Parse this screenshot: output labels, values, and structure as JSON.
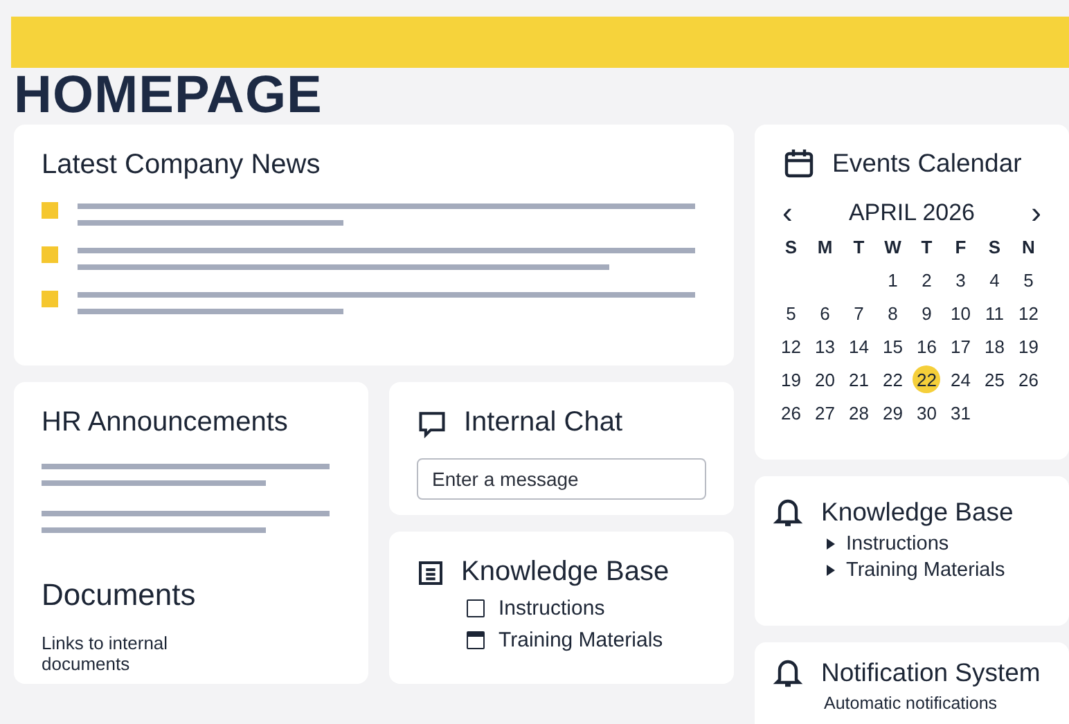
{
  "page_title": "HOMEPAGE",
  "news": {
    "title": "Latest Company News"
  },
  "hr": {
    "title": "HR Announcements"
  },
  "documents": {
    "title": "Documents",
    "description": "Links to internal documents"
  },
  "chat": {
    "title": "Internal Chat",
    "placeholder": "Enter a message"
  },
  "knowledge_base": {
    "title": "Knowledge Base",
    "items": [
      {
        "label": "Instructions",
        "checked": false
      },
      {
        "label": "Training Materials",
        "checked": true
      }
    ]
  },
  "calendar": {
    "title": "Events Calendar",
    "prev": "‹",
    "month": "APRIL 2026",
    "next": "›",
    "weekdays": [
      "S",
      "M",
      "T",
      "W",
      "T",
      "F",
      "S",
      "N"
    ],
    "weeks": [
      [
        {
          "day": "1",
          "selected": false
        },
        {
          "day": "2",
          "selected": false
        },
        {
          "day": "3",
          "selected": false
        },
        {
          "day": "4",
          "selected": false
        },
        {
          "day": "5",
          "selected": false
        }
      ],
      [
        {
          "day": "5",
          "selected": false
        },
        {
          "day": "6",
          "selected": false
        },
        {
          "day": "7",
          "selected": false
        },
        {
          "day": "8",
          "selected": false
        },
        {
          "day": "9",
          "selected": false
        },
        {
          "day": "10",
          "selected": false
        },
        {
          "day": "11",
          "selected": false
        },
        {
          "day": "12",
          "selected": false
        }
      ],
      [
        {
          "day": "12",
          "selected": false
        },
        {
          "day": "13",
          "selected": false
        },
        {
          "day": "14",
          "selected": false
        },
        {
          "day": "15",
          "selected": false
        },
        {
          "day": "16",
          "selected": false
        },
        {
          "day": "17",
          "selected": false
        },
        {
          "day": "18",
          "selected": false
        },
        {
          "day": "19",
          "selected": false
        }
      ],
      [
        {
          "day": "19",
          "selected": false
        },
        {
          "day": "20",
          "selected": false
        },
        {
          "day": "21",
          "selected": false
        },
        {
          "day": "22",
          "selected": false
        },
        {
          "day": "22",
          "selected": true
        },
        {
          "day": "24",
          "selected": false
        },
        {
          "day": "25",
          "selected": false
        },
        {
          "day": "26",
          "selected": false
        }
      ],
      [
        {
          "day": "26",
          "selected": false
        },
        {
          "day": "27",
          "selected": false
        },
        {
          "day": "28",
          "selected": false
        },
        {
          "day": "29",
          "selected": false
        },
        {
          "day": "30",
          "selected": false
        },
        {
          "day": "31",
          "selected": false
        }
      ]
    ]
  },
  "knowledge_base_2": {
    "title": "Knowledge Base",
    "items": [
      {
        "label": "Instructions",
        "expanded": false
      },
      {
        "label": "Training Materials",
        "expanded": false
      }
    ]
  },
  "notifications": {
    "title": "Notification System",
    "description": "Automatic notifications"
  }
}
